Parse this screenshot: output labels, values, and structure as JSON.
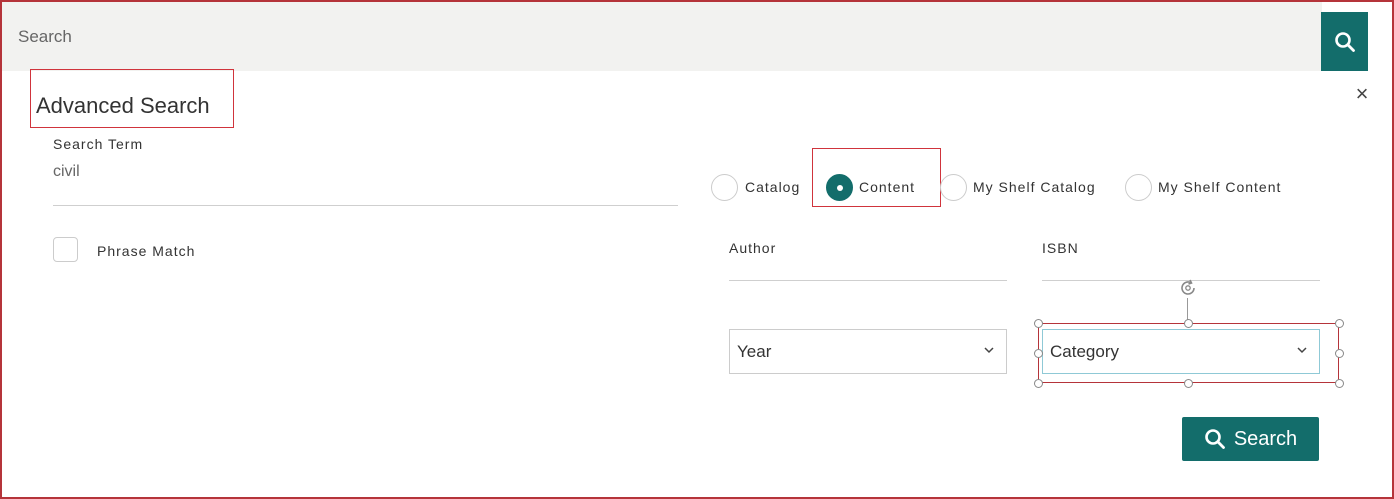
{
  "search_bar": {
    "placeholder": "Search"
  },
  "advanced": {
    "title": "Advanced Search",
    "search_term_label": "Search Term",
    "search_term_value": "civil",
    "phrase_match_label": "Phrase Match",
    "phrase_match_checked": false,
    "close_symbol": "×"
  },
  "scope_options": [
    {
      "label": "Catalog",
      "checked": false
    },
    {
      "label": "Content",
      "checked": true
    },
    {
      "label": "My Shelf Catalog",
      "checked": false
    },
    {
      "label": "My Shelf Content",
      "checked": false
    }
  ],
  "fields": {
    "author_label": "Author",
    "isbn_label": "ISBN",
    "year_selected": "Year",
    "category_selected": "Category"
  },
  "search_button": {
    "label": "Search"
  },
  "colors": {
    "accent": "#136d6b",
    "highlight": "#d0343c"
  },
  "icons": {
    "search": "search-icon",
    "close": "close-icon",
    "dropdown": "chevron-down-icon",
    "rotate": "rotate-icon"
  }
}
